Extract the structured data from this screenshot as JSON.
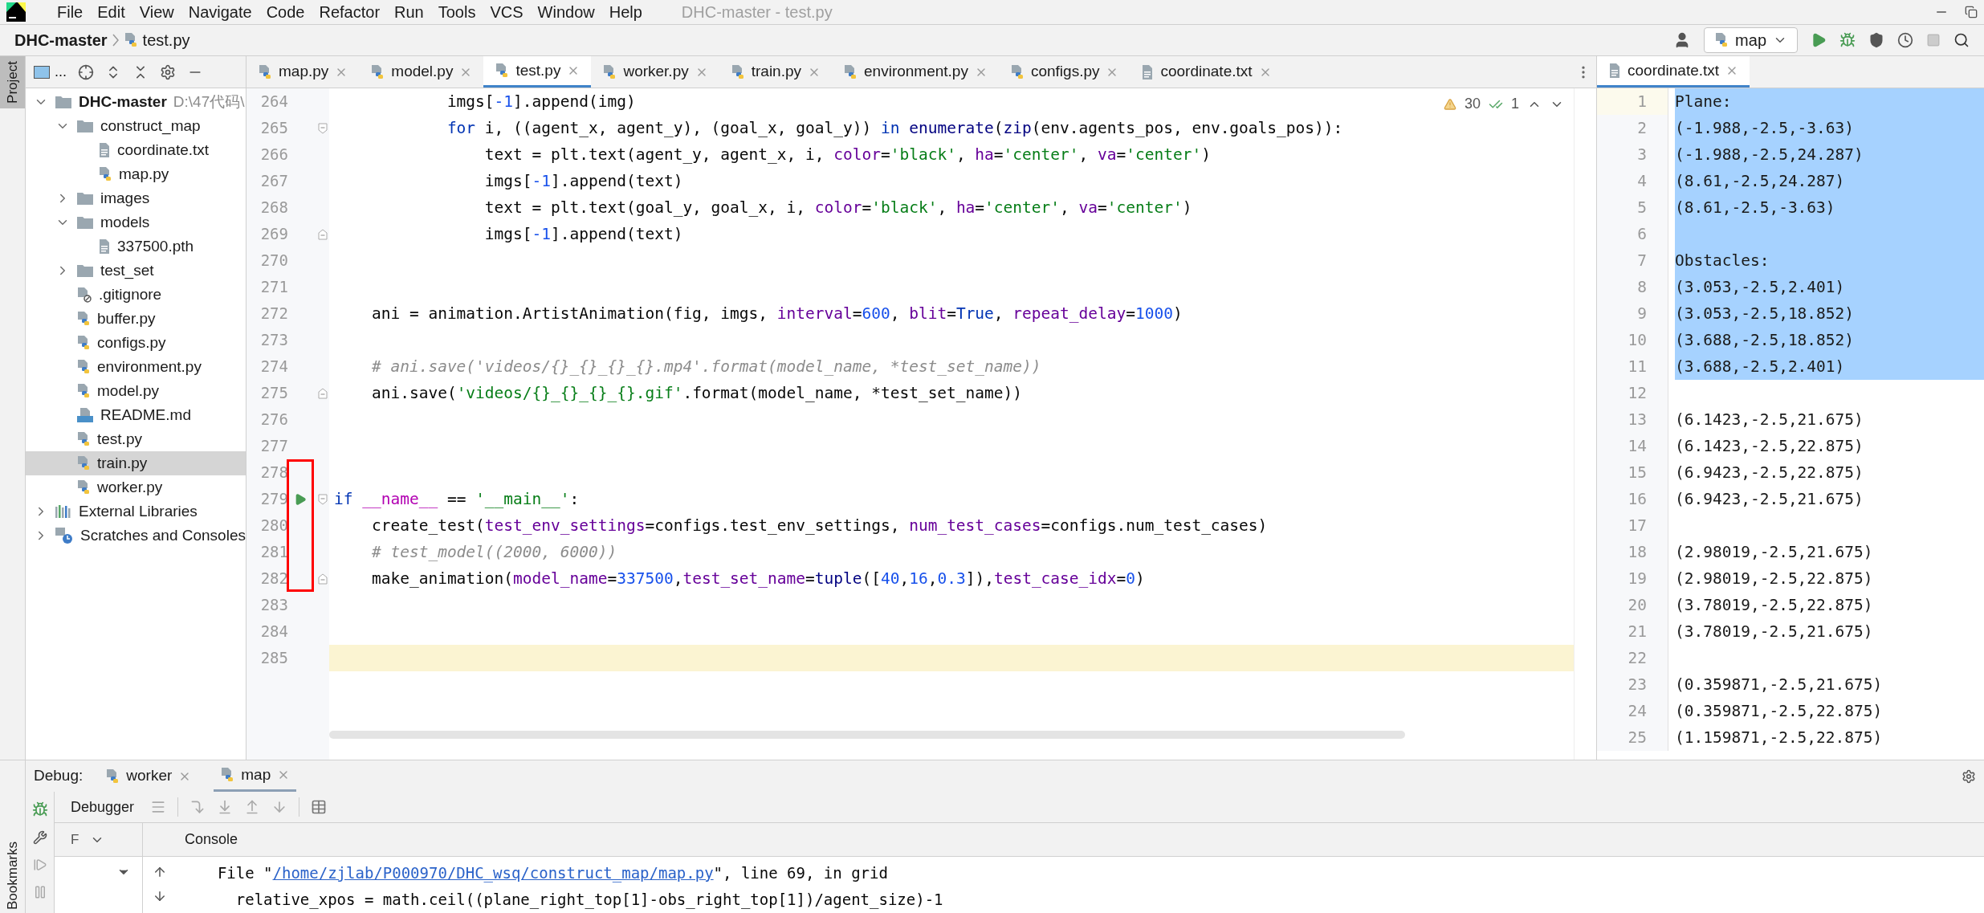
{
  "window": {
    "title": "DHC-master - test.py"
  },
  "menu": [
    "File",
    "Edit",
    "View",
    "Navigate",
    "Code",
    "Refactor",
    "Run",
    "Tools",
    "VCS",
    "Window",
    "Help"
  ],
  "breadcrumb": {
    "project": "DHC-master",
    "file": "test.py"
  },
  "run_config": {
    "label": "map"
  },
  "tool_windows": {
    "top": "Project",
    "bottom": "Bookmarks"
  },
  "project_panel": {
    "view_label": "...",
    "tree": [
      {
        "label": "DHC-master",
        "path": "D:\\47代码\\",
        "kind": "folder",
        "expanded": true,
        "selected": false,
        "children": [
          {
            "label": "construct_map",
            "kind": "folder",
            "expanded": true,
            "selected": false,
            "children": [
              {
                "label": "coordinate.txt",
                "kind": "txt",
                "selected": false
              },
              {
                "label": "map.py",
                "kind": "py",
                "selected": false
              }
            ]
          },
          {
            "label": "images",
            "kind": "folder",
            "expanded": false,
            "selected": false
          },
          {
            "label": "models",
            "kind": "folder",
            "expanded": true,
            "selected": false,
            "children": [
              {
                "label": "337500.pth",
                "kind": "txt",
                "selected": false
              }
            ]
          },
          {
            "label": "test_set",
            "kind": "folder",
            "expanded": false,
            "selected": false
          },
          {
            "label": ".gitignore",
            "kind": "git",
            "selected": false
          },
          {
            "label": "buffer.py",
            "kind": "py",
            "selected": false
          },
          {
            "label": "configs.py",
            "kind": "py",
            "selected": false
          },
          {
            "label": "environment.py",
            "kind": "py",
            "selected": false
          },
          {
            "label": "model.py",
            "kind": "py",
            "selected": false
          },
          {
            "label": "README.md",
            "kind": "md",
            "selected": false
          },
          {
            "label": "test.py",
            "kind": "py",
            "selected": false
          },
          {
            "label": "train.py",
            "kind": "py",
            "selected": true
          },
          {
            "label": "worker.py",
            "kind": "py",
            "selected": false
          }
        ]
      },
      {
        "label": "External Libraries",
        "kind": "libs",
        "expanded": false,
        "selected": false
      },
      {
        "label": "Scratches and Consoles",
        "kind": "scratches",
        "expanded": false,
        "selected": false
      }
    ]
  },
  "editor_tabs": [
    {
      "label": "map.py",
      "kind": "py",
      "selected": false
    },
    {
      "label": "model.py",
      "kind": "py",
      "selected": false
    },
    {
      "label": "test.py",
      "kind": "py",
      "selected": true
    },
    {
      "label": "worker.py",
      "kind": "py",
      "selected": false
    },
    {
      "label": "train.py",
      "kind": "py",
      "selected": false
    },
    {
      "label": "environment.py",
      "kind": "py",
      "selected": false
    },
    {
      "label": "configs.py",
      "kind": "py",
      "selected": false
    },
    {
      "label": "coordinate.txt",
      "kind": "txt",
      "selected": false
    }
  ],
  "inspections": {
    "warnings": "30",
    "weak_warnings": "1"
  },
  "code": [
    {
      "number": "264",
      "current": false,
      "boxed": false,
      "segments": [
        {
          "kind": "plain",
          "text": "            imgs["
        },
        {
          "kind": "number",
          "text": "-1"
        },
        {
          "kind": "plain",
          "text": "].append(img)"
        }
      ]
    },
    {
      "number": "265",
      "current": false,
      "boxed": false,
      "fold_start": true,
      "segments": [
        {
          "kind": "keyword",
          "text": "            for"
        },
        {
          "kind": "plain",
          "text": " i, ((agent_x, agent_y), (goal_x, goal_y)) "
        },
        {
          "kind": "keyword",
          "text": "in "
        },
        {
          "kind": "builtin",
          "text": "enumerate"
        },
        {
          "kind": "plain",
          "text": "("
        },
        {
          "kind": "builtin",
          "text": "zip"
        },
        {
          "kind": "plain",
          "text": "(env.agents_pos, env.goals_pos)):"
        }
      ]
    },
    {
      "number": "266",
      "current": false,
      "boxed": false,
      "segments": [
        {
          "kind": "plain",
          "text": "                text = plt.text(agent_y, agent_x, i, "
        },
        {
          "kind": "param",
          "text": "color"
        },
        {
          "kind": "plain",
          "text": "="
        },
        {
          "kind": "string",
          "text": "'black'"
        },
        {
          "kind": "plain",
          "text": ", "
        },
        {
          "kind": "param",
          "text": "ha"
        },
        {
          "kind": "plain",
          "text": "="
        },
        {
          "kind": "string",
          "text": "'center'"
        },
        {
          "kind": "plain",
          "text": ", "
        },
        {
          "kind": "param",
          "text": "va"
        },
        {
          "kind": "plain",
          "text": "="
        },
        {
          "kind": "string",
          "text": "'center'"
        },
        {
          "kind": "plain",
          "text": ")"
        }
      ]
    },
    {
      "number": "267",
      "current": false,
      "boxed": false,
      "segments": [
        {
          "kind": "plain",
          "text": "                imgs["
        },
        {
          "kind": "number",
          "text": "-1"
        },
        {
          "kind": "plain",
          "text": "].append(text)"
        }
      ]
    },
    {
      "number": "268",
      "current": false,
      "boxed": false,
      "segments": [
        {
          "kind": "plain",
          "text": "                text = plt.text(goal_y, goal_x, i, "
        },
        {
          "kind": "param",
          "text": "color"
        },
        {
          "kind": "plain",
          "text": "="
        },
        {
          "kind": "string",
          "text": "'black'"
        },
        {
          "kind": "plain",
          "text": ", "
        },
        {
          "kind": "param",
          "text": "ha"
        },
        {
          "kind": "plain",
          "text": "="
        },
        {
          "kind": "string",
          "text": "'center'"
        },
        {
          "kind": "plain",
          "text": ", "
        },
        {
          "kind": "param",
          "text": "va"
        },
        {
          "kind": "plain",
          "text": "="
        },
        {
          "kind": "string",
          "text": "'center'"
        },
        {
          "kind": "plain",
          "text": ")"
        }
      ]
    },
    {
      "number": "269",
      "current": false,
      "boxed": false,
      "fold_end": true,
      "segments": [
        {
          "kind": "plain",
          "text": "                imgs["
        },
        {
          "kind": "number",
          "text": "-1"
        },
        {
          "kind": "plain",
          "text": "].append(text)"
        }
      ]
    },
    {
      "number": "270",
      "current": false,
      "boxed": false
    },
    {
      "number": "271",
      "current": false,
      "boxed": false
    },
    {
      "number": "272",
      "current": false,
      "boxed": false,
      "segments": [
        {
          "kind": "plain",
          "text": "    ani = animation.ArtistAnimation(fig, imgs, "
        },
        {
          "kind": "param",
          "text": "interval"
        },
        {
          "kind": "plain",
          "text": "="
        },
        {
          "kind": "number",
          "text": "600"
        },
        {
          "kind": "plain",
          "text": ", "
        },
        {
          "kind": "param",
          "text": "blit"
        },
        {
          "kind": "plain",
          "text": "="
        },
        {
          "kind": "keyword",
          "text": "True"
        },
        {
          "kind": "plain",
          "text": ", "
        },
        {
          "kind": "param",
          "text": "repeat_delay"
        },
        {
          "kind": "plain",
          "text": "="
        },
        {
          "kind": "number",
          "text": "1000"
        },
        {
          "kind": "plain",
          "text": ")"
        }
      ]
    },
    {
      "number": "273",
      "current": false,
      "boxed": false
    },
    {
      "number": "274",
      "current": false,
      "boxed": false,
      "segments": [
        {
          "kind": "comment",
          "text": "    # ani.save('videos/{}_{}_{}_{}.mp4'.format(model_name, *test_set_name))"
        }
      ]
    },
    {
      "number": "275",
      "current": false,
      "boxed": false,
      "fold_end": true,
      "segments": [
        {
          "kind": "plain",
          "text": "    ani.save("
        },
        {
          "kind": "string",
          "text": "'videos/{}_{}_{}_{}.gif'"
        },
        {
          "kind": "plain",
          "text": ".format(model_name, *test_set_name))"
        }
      ]
    },
    {
      "number": "276",
      "current": false,
      "boxed": false
    },
    {
      "number": "277",
      "current": false,
      "boxed": false
    },
    {
      "number": "278",
      "current": false,
      "boxed": true
    },
    {
      "number": "279",
      "current": false,
      "boxed": true,
      "run": true,
      "fold_start": true,
      "segments": [
        {
          "kind": "keyword",
          "text": "if "
        },
        {
          "kind": "dunder",
          "text": "__name__"
        },
        {
          "kind": "plain",
          "text": " == "
        },
        {
          "kind": "string",
          "text": "'__main__'"
        },
        {
          "kind": "plain",
          "text": ":"
        }
      ]
    },
    {
      "number": "280",
      "current": false,
      "boxed": true,
      "segments": [
        {
          "kind": "plain",
          "text": "    create_test("
        },
        {
          "kind": "param",
          "text": "test_env_settings"
        },
        {
          "kind": "plain",
          "text": "=configs.test_env_settings, "
        },
        {
          "kind": "param",
          "text": "num_test_cases"
        },
        {
          "kind": "plain",
          "text": "=configs.num_test_cases)"
        }
      ]
    },
    {
      "number": "281",
      "current": false,
      "boxed": true,
      "segments": [
        {
          "kind": "comment",
          "text": "    # test_model((2000, 6000))"
        }
      ]
    },
    {
      "number": "282",
      "current": false,
      "boxed": true,
      "fold_end": true,
      "segments": [
        {
          "kind": "plain",
          "text": "    make_animation("
        },
        {
          "kind": "param",
          "text": "model_name"
        },
        {
          "kind": "plain",
          "text": "="
        },
        {
          "kind": "number",
          "text": "337500"
        },
        {
          "kind": "plain",
          "text": ","
        },
        {
          "kind": "param",
          "text": "test_set_name"
        },
        {
          "kind": "plain",
          "text": "="
        },
        {
          "kind": "builtin",
          "text": "tuple"
        },
        {
          "kind": "plain",
          "text": "(["
        },
        {
          "kind": "number",
          "text": "40"
        },
        {
          "kind": "plain",
          "text": ","
        },
        {
          "kind": "number",
          "text": "16"
        },
        {
          "kind": "plain",
          "text": ","
        },
        {
          "kind": "number",
          "text": "0.3"
        },
        {
          "kind": "plain",
          "text": "]),"
        },
        {
          "kind": "param",
          "text": "test_case_idx"
        },
        {
          "kind": "plain",
          "text": "="
        },
        {
          "kind": "number",
          "text": "0"
        },
        {
          "kind": "plain",
          "text": ")"
        }
      ]
    },
    {
      "number": "283",
      "current": false,
      "boxed": false
    },
    {
      "number": "284",
      "current": false,
      "boxed": false
    },
    {
      "number": "285",
      "current": true,
      "boxed": false
    }
  ],
  "side_editor": {
    "tab": {
      "label": "coordinate.txt",
      "selected": true
    },
    "lines": [
      {
        "number": "1",
        "text": "Plane:",
        "selected": true,
        "current": true
      },
      {
        "number": "2",
        "text": "(-1.988,-2.5,-3.63)",
        "selected": true,
        "current": false
      },
      {
        "number": "3",
        "text": "(-1.988,-2.5,24.287)",
        "selected": true,
        "current": false
      },
      {
        "number": "4",
        "text": "(8.61,-2.5,24.287)",
        "selected": true,
        "current": false
      },
      {
        "number": "5",
        "text": "(8.61,-2.5,-3.63)",
        "selected": true,
        "current": false
      },
      {
        "number": "6",
        "selected": true,
        "current": false
      },
      {
        "number": "7",
        "text": "Obstacles:",
        "selected": true,
        "current": false
      },
      {
        "number": "8",
        "text": "(3.053,-2.5,2.401)",
        "selected": true,
        "current": false
      },
      {
        "number": "9",
        "text": "(3.053,-2.5,18.852)",
        "selected": true,
        "current": false
      },
      {
        "number": "10",
        "text": "(3.688,-2.5,18.852)",
        "selected": true,
        "current": false
      },
      {
        "number": "11",
        "text": "(3.688,-2.5,2.401)",
        "selected": true,
        "current": false
      },
      {
        "number": "12",
        "selected": false,
        "current": false
      },
      {
        "number": "13",
        "text": "(6.1423,-2.5,21.675)",
        "selected": false,
        "current": false
      },
      {
        "number": "14",
        "text": "(6.1423,-2.5,22.875)",
        "selected": false,
        "current": false
      },
      {
        "number": "15",
        "text": "(6.9423,-2.5,22.875)",
        "selected": false,
        "current": false
      },
      {
        "number": "16",
        "text": "(6.9423,-2.5,21.675)",
        "selected": false,
        "current": false
      },
      {
        "number": "17",
        "selected": false,
        "current": false
      },
      {
        "number": "18",
        "text": "(2.98019,-2.5,21.675)",
        "selected": false,
        "current": false
      },
      {
        "number": "19",
        "text": "(2.98019,-2.5,22.875)",
        "selected": false,
        "current": false
      },
      {
        "number": "20",
        "text": "(3.78019,-2.5,22.875)",
        "selected": false,
        "current": false
      },
      {
        "number": "21",
        "text": "(3.78019,-2.5,21.675)",
        "selected": false,
        "current": false
      },
      {
        "number": "22",
        "selected": false,
        "current": false
      },
      {
        "number": "23",
        "text": "(0.359871,-2.5,21.675)",
        "selected": false,
        "current": false
      },
      {
        "number": "24",
        "text": "(0.359871,-2.5,22.875)",
        "selected": false,
        "current": false
      },
      {
        "number": "25",
        "text": "(1.159871,-2.5,22.875)",
        "selected": false,
        "current": false
      }
    ]
  },
  "debug": {
    "label": "Debug:",
    "sessions": [
      {
        "label": "worker",
        "selected": false
      },
      {
        "label": "map",
        "selected": true
      }
    ],
    "tabs": [
      {
        "label": "Debugger",
        "selected": false
      }
    ],
    "frames_label": "F",
    "console_tab": "Console",
    "console": [
      [
        {
          "kind": "plain",
          "text": "  File \""
        },
        {
          "kind": "link",
          "text": "/home/zjlab/P000970/DHC_wsq/construct_map/map.py"
        },
        {
          "kind": "plain",
          "text": "\", line 69, in grid"
        }
      ],
      [
        {
          "kind": "plain",
          "text": "    relative_xpos = math.ceil((plane_right_top[1]-obs_right_top[1])/agent_size)-1"
        }
      ]
    ]
  }
}
